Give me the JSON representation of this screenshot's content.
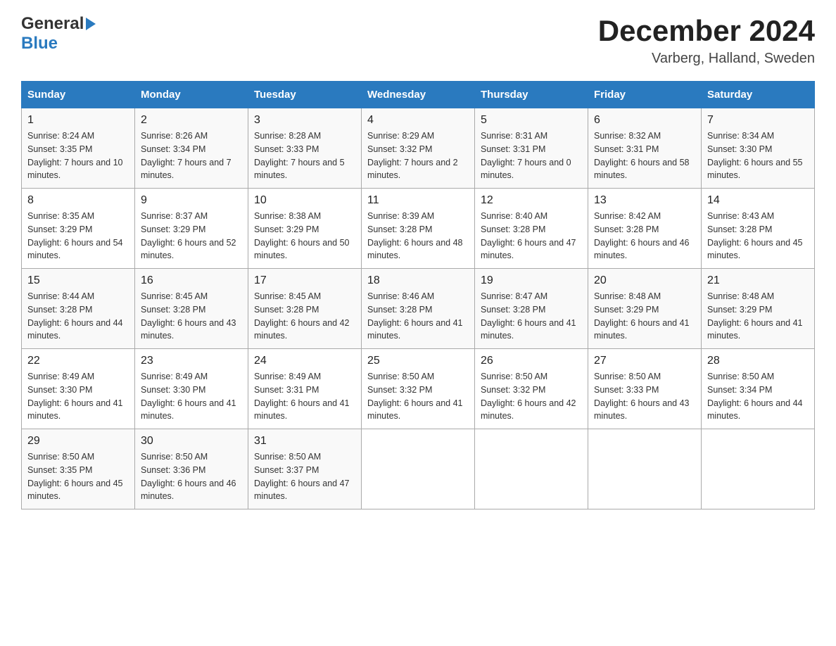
{
  "header": {
    "logo_general": "General",
    "logo_blue": "Blue",
    "title": "December 2024",
    "subtitle": "Varberg, Halland, Sweden"
  },
  "calendar": {
    "weekdays": [
      "Sunday",
      "Monday",
      "Tuesday",
      "Wednesday",
      "Thursday",
      "Friday",
      "Saturday"
    ],
    "weeks": [
      [
        {
          "day": "1",
          "sunrise": "8:24 AM",
          "sunset": "3:35 PM",
          "daylight": "7 hours and 10 minutes."
        },
        {
          "day": "2",
          "sunrise": "8:26 AM",
          "sunset": "3:34 PM",
          "daylight": "7 hours and 7 minutes."
        },
        {
          "day": "3",
          "sunrise": "8:28 AM",
          "sunset": "3:33 PM",
          "daylight": "7 hours and 5 minutes."
        },
        {
          "day": "4",
          "sunrise": "8:29 AM",
          "sunset": "3:32 PM",
          "daylight": "7 hours and 2 minutes."
        },
        {
          "day": "5",
          "sunrise": "8:31 AM",
          "sunset": "3:31 PM",
          "daylight": "7 hours and 0 minutes."
        },
        {
          "day": "6",
          "sunrise": "8:32 AM",
          "sunset": "3:31 PM",
          "daylight": "6 hours and 58 minutes."
        },
        {
          "day": "7",
          "sunrise": "8:34 AM",
          "sunset": "3:30 PM",
          "daylight": "6 hours and 55 minutes."
        }
      ],
      [
        {
          "day": "8",
          "sunrise": "8:35 AM",
          "sunset": "3:29 PM",
          "daylight": "6 hours and 54 minutes."
        },
        {
          "day": "9",
          "sunrise": "8:37 AM",
          "sunset": "3:29 PM",
          "daylight": "6 hours and 52 minutes."
        },
        {
          "day": "10",
          "sunrise": "8:38 AM",
          "sunset": "3:29 PM",
          "daylight": "6 hours and 50 minutes."
        },
        {
          "day": "11",
          "sunrise": "8:39 AM",
          "sunset": "3:28 PM",
          "daylight": "6 hours and 48 minutes."
        },
        {
          "day": "12",
          "sunrise": "8:40 AM",
          "sunset": "3:28 PM",
          "daylight": "6 hours and 47 minutes."
        },
        {
          "day": "13",
          "sunrise": "8:42 AM",
          "sunset": "3:28 PM",
          "daylight": "6 hours and 46 minutes."
        },
        {
          "day": "14",
          "sunrise": "8:43 AM",
          "sunset": "3:28 PM",
          "daylight": "6 hours and 45 minutes."
        }
      ],
      [
        {
          "day": "15",
          "sunrise": "8:44 AM",
          "sunset": "3:28 PM",
          "daylight": "6 hours and 44 minutes."
        },
        {
          "day": "16",
          "sunrise": "8:45 AM",
          "sunset": "3:28 PM",
          "daylight": "6 hours and 43 minutes."
        },
        {
          "day": "17",
          "sunrise": "8:45 AM",
          "sunset": "3:28 PM",
          "daylight": "6 hours and 42 minutes."
        },
        {
          "day": "18",
          "sunrise": "8:46 AM",
          "sunset": "3:28 PM",
          "daylight": "6 hours and 41 minutes."
        },
        {
          "day": "19",
          "sunrise": "8:47 AM",
          "sunset": "3:28 PM",
          "daylight": "6 hours and 41 minutes."
        },
        {
          "day": "20",
          "sunrise": "8:48 AM",
          "sunset": "3:29 PM",
          "daylight": "6 hours and 41 minutes."
        },
        {
          "day": "21",
          "sunrise": "8:48 AM",
          "sunset": "3:29 PM",
          "daylight": "6 hours and 41 minutes."
        }
      ],
      [
        {
          "day": "22",
          "sunrise": "8:49 AM",
          "sunset": "3:30 PM",
          "daylight": "6 hours and 41 minutes."
        },
        {
          "day": "23",
          "sunrise": "8:49 AM",
          "sunset": "3:30 PM",
          "daylight": "6 hours and 41 minutes."
        },
        {
          "day": "24",
          "sunrise": "8:49 AM",
          "sunset": "3:31 PM",
          "daylight": "6 hours and 41 minutes."
        },
        {
          "day": "25",
          "sunrise": "8:50 AM",
          "sunset": "3:32 PM",
          "daylight": "6 hours and 41 minutes."
        },
        {
          "day": "26",
          "sunrise": "8:50 AM",
          "sunset": "3:32 PM",
          "daylight": "6 hours and 42 minutes."
        },
        {
          "day": "27",
          "sunrise": "8:50 AM",
          "sunset": "3:33 PM",
          "daylight": "6 hours and 43 minutes."
        },
        {
          "day": "28",
          "sunrise": "8:50 AM",
          "sunset": "3:34 PM",
          "daylight": "6 hours and 44 minutes."
        }
      ],
      [
        {
          "day": "29",
          "sunrise": "8:50 AM",
          "sunset": "3:35 PM",
          "daylight": "6 hours and 45 minutes."
        },
        {
          "day": "30",
          "sunrise": "8:50 AM",
          "sunset": "3:36 PM",
          "daylight": "6 hours and 46 minutes."
        },
        {
          "day": "31",
          "sunrise": "8:50 AM",
          "sunset": "3:37 PM",
          "daylight": "6 hours and 47 minutes."
        },
        null,
        null,
        null,
        null
      ]
    ]
  }
}
